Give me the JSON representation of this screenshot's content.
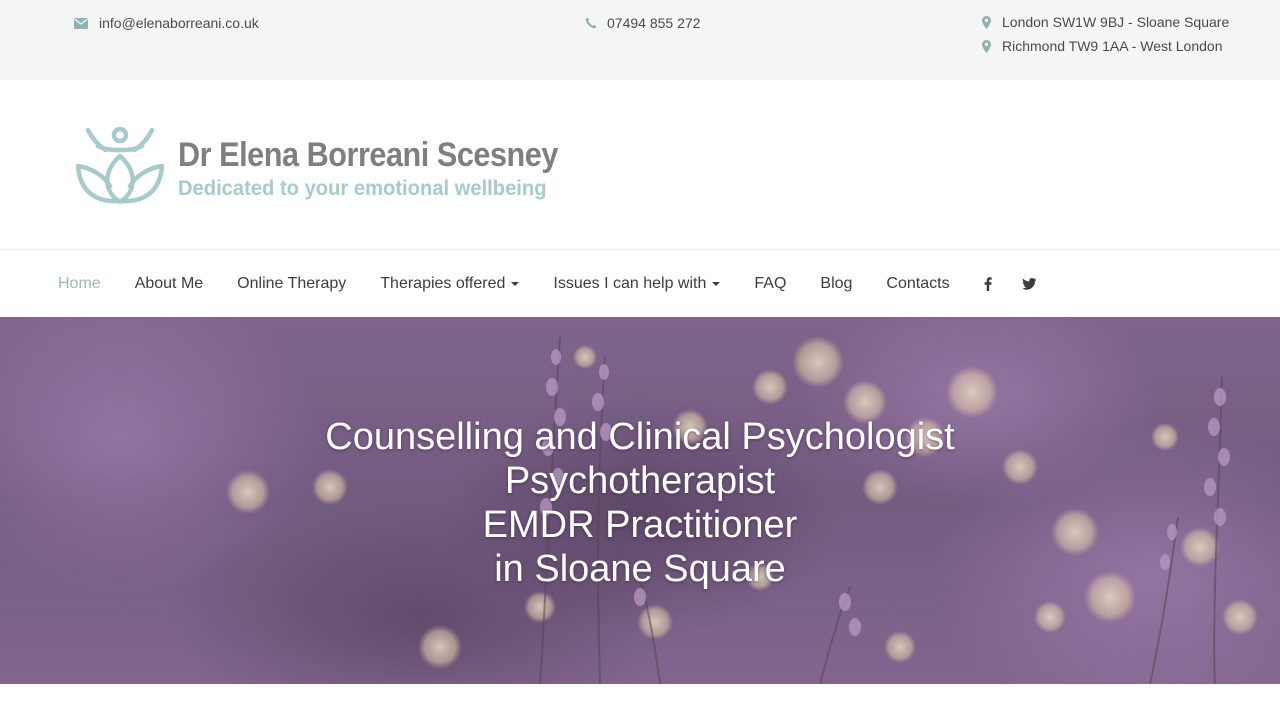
{
  "topbar": {
    "email": "info@elenaborreani.co.uk",
    "phone": "07494 855 272",
    "addresses": [
      "London SW1W 9BJ - Sloane Square",
      "Richmond TW9 1AA - West London"
    ],
    "icons": {
      "email": "envelope-icon",
      "phone": "phone-icon",
      "address": "map-marker-icon"
    }
  },
  "header": {
    "logo_name": "Dr Elena Borreani Scesney",
    "logo_tagline": "Dedicated to your emotional wellbeing",
    "logo_icon": "lotus-figure-icon"
  },
  "nav": {
    "items": [
      {
        "label": "Home",
        "active": true,
        "dropdown": false
      },
      {
        "label": "About Me",
        "active": false,
        "dropdown": false
      },
      {
        "label": "Online Therapy",
        "active": false,
        "dropdown": false
      },
      {
        "label": "Therapies offered",
        "active": false,
        "dropdown": true
      },
      {
        "label": "Issues I can help with",
        "active": false,
        "dropdown": true
      },
      {
        "label": "FAQ",
        "active": false,
        "dropdown": false
      },
      {
        "label": "Blog",
        "active": false,
        "dropdown": false
      },
      {
        "label": "Contacts",
        "active": false,
        "dropdown": false
      }
    ],
    "social": [
      "facebook-icon",
      "twitter-icon"
    ]
  },
  "hero": {
    "lines": [
      "Counselling and Clinical Psychologist",
      "Psychotherapist",
      "EMDR Practitioner",
      "in Sloane Square"
    ]
  },
  "colors": {
    "topbar_bg": "#f4f5f5",
    "brand_grey": "#7f7f7f",
    "brand_teal": "#a7cbcb",
    "nav_active": "#9fb8b8",
    "hero_purple": "#7d6488"
  }
}
